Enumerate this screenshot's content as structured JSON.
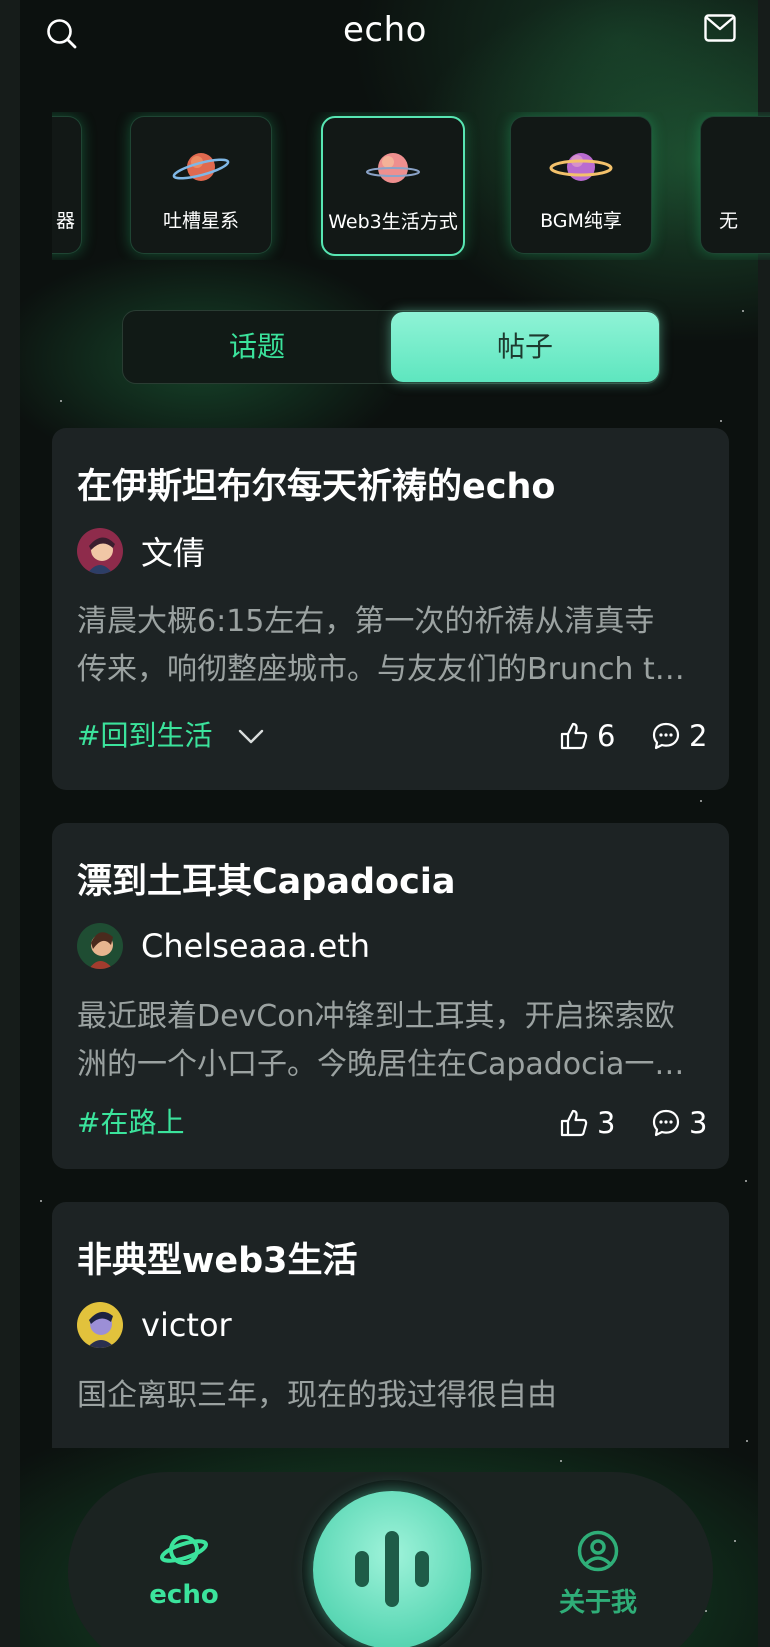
{
  "header": {
    "title": "echo"
  },
  "categories": [
    {
      "label": "器"
    },
    {
      "label": "吐槽星系"
    },
    {
      "label": "Web3生活方式",
      "active": true
    },
    {
      "label": "BGM纯享"
    },
    {
      "label": "无"
    }
  ],
  "tabs": {
    "topic": "话题",
    "post": "帖子",
    "selected": "帖子"
  },
  "posts": [
    {
      "title": "在伊斯坦布尔每天祈祷的echo",
      "author": "文倩",
      "excerpt_line1": "清晨大概6:15左右，第一次的祈祷从清真寺",
      "excerpt_line2": "传来，响彻整座城市。与友友们的Brunch t…",
      "tag": "#回到生活",
      "likes": "6",
      "comments": "2"
    },
    {
      "title": "漂到土耳其Capadocia",
      "author": "Chelseaaa.eth",
      "excerpt_line1": "最近跟着DevCon冲锋到土耳其，开启探索欧",
      "excerpt_line2": "洲的一个小口子。今晚居住在Capadocia一…",
      "tag": "#在路上",
      "likes": "3",
      "comments": "3"
    },
    {
      "title": "非典型web3生活",
      "author": "victor",
      "excerpt_line1": "国企离职三年，现在的我过得很自由"
    }
  ],
  "nav": {
    "home_label": "echo",
    "me_label": "关于我"
  },
  "colors": {
    "accent": "#3be39c",
    "card": "#1d2324",
    "active_tab": "#7deecb"
  }
}
